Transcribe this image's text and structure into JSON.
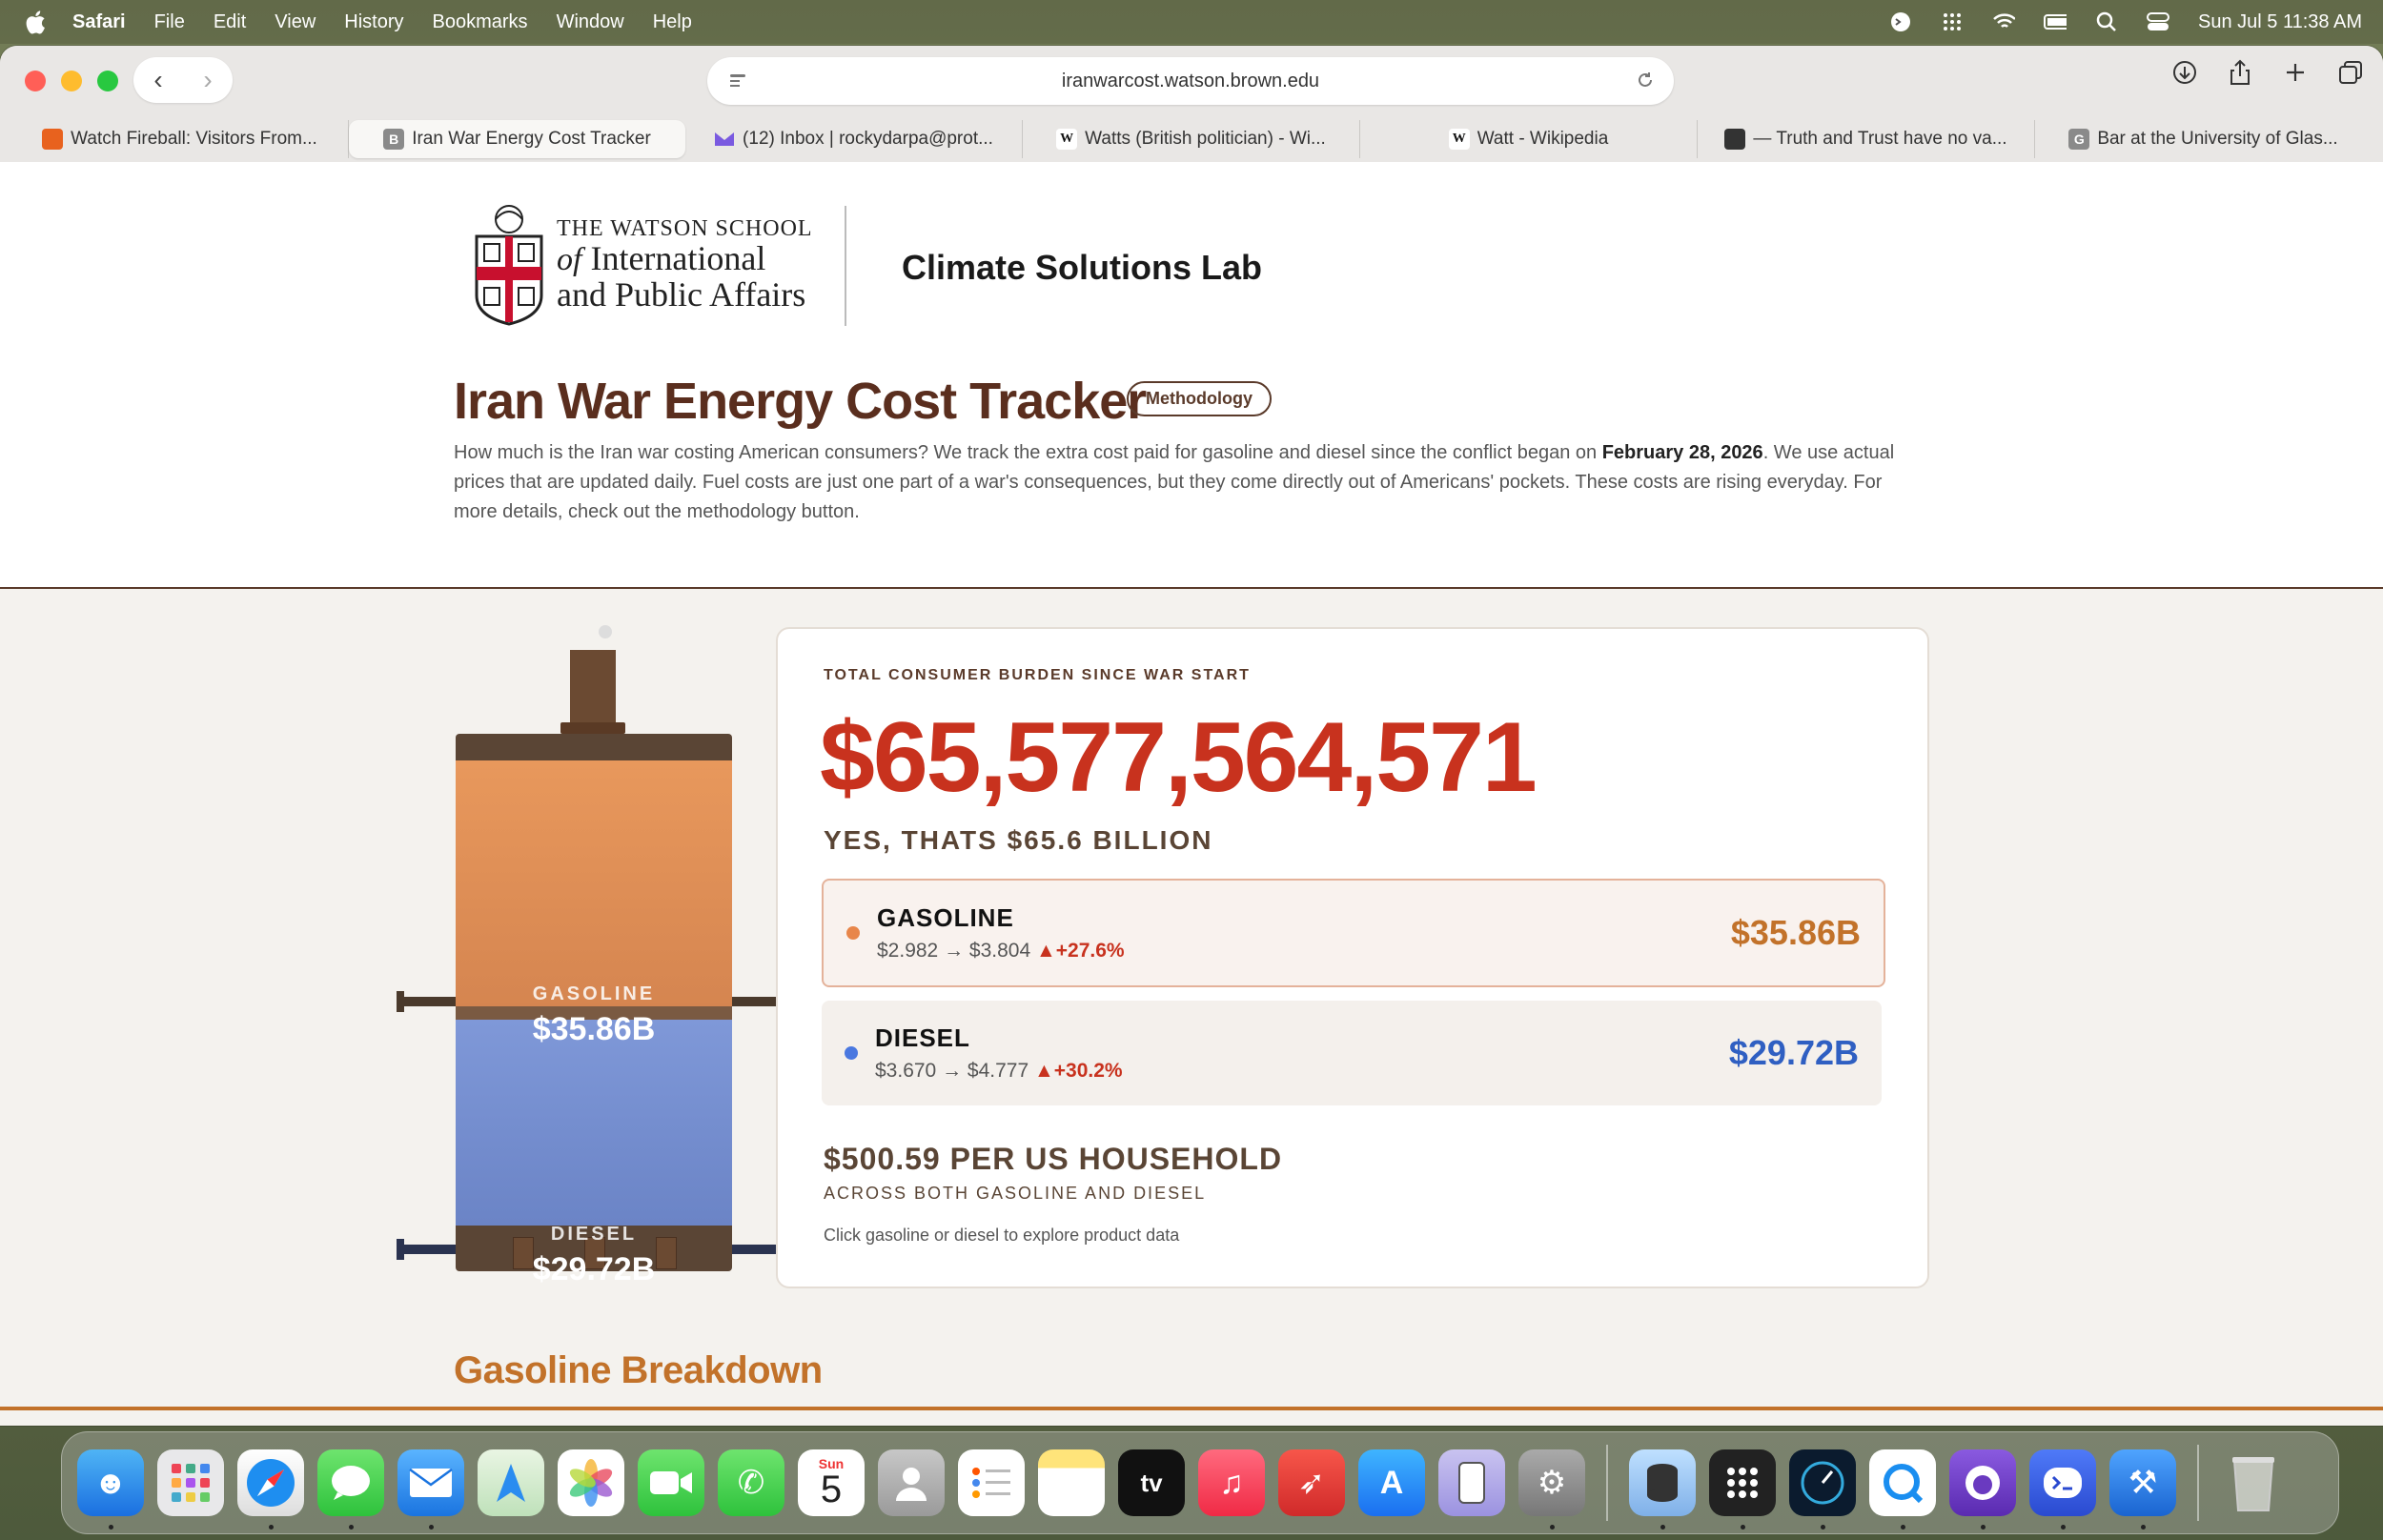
{
  "menubar": {
    "app": "Safari",
    "items": [
      "File",
      "Edit",
      "View",
      "History",
      "Bookmarks",
      "Window",
      "Help"
    ],
    "datetime": "Sun Jul 5  11:38 AM"
  },
  "browser": {
    "url": "iranwarcost.watson.brown.edu",
    "tabs": [
      {
        "label": "Watch Fireball: Visitors From...",
        "favicon": "",
        "color": "#e8621e"
      },
      {
        "label": "Iran War Energy Cost Tracker",
        "favicon": "B",
        "color": "#8a8a8a"
      },
      {
        "label": "(12) Inbox | rockydarpa@prot...",
        "favicon": "",
        "color": "#7a5ae0"
      },
      {
        "label": "Watts (British politician) - Wi...",
        "favicon": "W",
        "color": "#ffffff"
      },
      {
        "label": "Watt - Wikipedia",
        "favicon": "W",
        "color": "#ffffff"
      },
      {
        "label": "— Truth and Trust have no va...",
        "favicon": "",
        "color": "#333333"
      },
      {
        "label": "Bar at the University of Glas...",
        "favicon": "G",
        "color": "#8a8a8a"
      }
    ]
  },
  "header": {
    "logo_line1": "THE WATSON SCHOOL",
    "logo_of": "of",
    "logo_line2": "International",
    "logo_line3": "and Public Affairs",
    "lab": "Climate Solutions Lab",
    "title": "Iran War Energy Cost Tracker",
    "methodology": "Methodology",
    "intro_a": "How much is the Iran war costing American consumers? We track the extra cost paid for gasoline and diesel since the conflict began on ",
    "intro_date": "February 28, 2026",
    "intro_b": ". We use actual prices that are updated daily. Fuel costs are just one part of a war's consequences, but they come directly out of Americans' pockets. These costs are rising everyday. For more details, check out the methodology button."
  },
  "tank": {
    "gas_label": "GASOLINE",
    "gas_value": "$35.86B",
    "diesel_label": "DIESEL",
    "diesel_value": "$29.72B"
  },
  "card": {
    "label": "TOTAL CONSUMER BURDEN SINCE WAR START",
    "total": "$65,577,564,571",
    "subtitle": "YES, THATS $65.6 BILLION",
    "gasoline": {
      "name": "GASOLINE",
      "range": "$2.982 → $3.804 ",
      "change": "▲+27.6%",
      "value": "$35.86B",
      "color": "#c2722a",
      "dot": "#e8864a"
    },
    "diesel": {
      "name": "DIESEL",
      "range": "$3.670 → $4.777 ",
      "change": "▲+30.2%",
      "value": "$29.72B",
      "color": "#2f5fc2",
      "dot": "#4a78e0"
    },
    "household": "$500.59 PER US HOUSEHOLD",
    "household_sub": "ACROSS BOTH GASOLINE AND DIESEL",
    "hint": "Click gasoline or diesel to explore product data"
  },
  "section": {
    "breakdown": "Gasoline Breakdown"
  },
  "dock": {
    "calendar_month": "Sun",
    "calendar_day": "5"
  }
}
